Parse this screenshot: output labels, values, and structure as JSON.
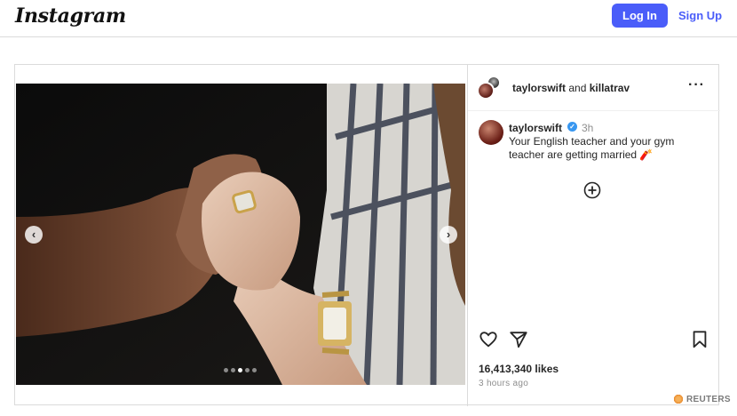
{
  "header": {
    "logo_text": "Instagram",
    "login_label": "Log In",
    "signup_label": "Sign Up",
    "accent_color": "#4a5df9"
  },
  "post": {
    "owner": "taylorswift",
    "conjunction": "and",
    "collaborator": "killatrav",
    "more_icon": "more-horizontal-icon",
    "caption": {
      "username": "taylorswift",
      "verified": true,
      "time": "3h",
      "text": "Your English teacher and your gym teacher are getting married 🧨"
    },
    "carousel": {
      "total_slides": 5,
      "active_slide": 3,
      "prev_icon": "chevron-left-icon",
      "next_icon": "chevron-right-icon"
    },
    "add_comment_icon": "plus-circle-icon",
    "actions": [
      "heart-icon",
      "share-icon",
      "bookmark-icon"
    ],
    "likes_text": "16,413,340 likes",
    "time_ago": "3 hours ago"
  },
  "watermark": {
    "text": "REUTERS"
  }
}
